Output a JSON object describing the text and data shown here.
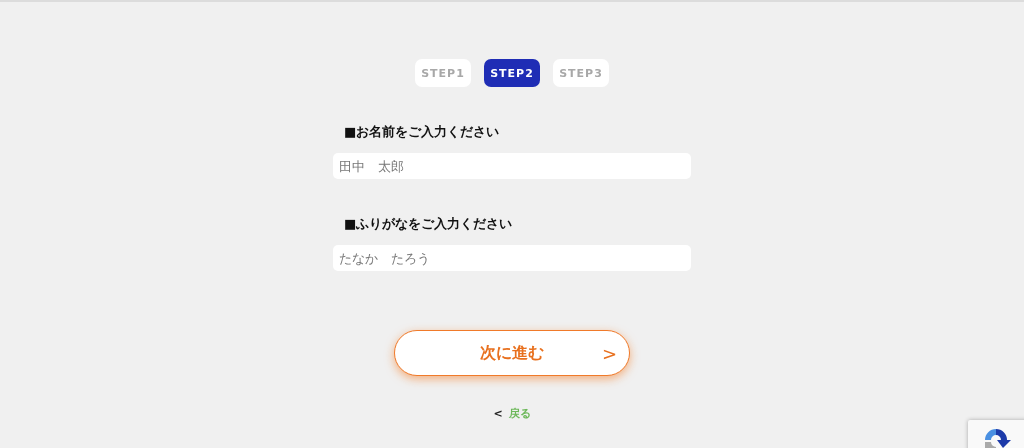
{
  "steps": [
    {
      "label": "STEP1",
      "selected": false
    },
    {
      "label": "STEP2",
      "selected": true
    },
    {
      "label": "STEP3",
      "selected": false
    }
  ],
  "fields": [
    {
      "label": "■お名前をご入力ください",
      "placeholder": "田中　太郎"
    },
    {
      "label": "■ふりがなをご入力ください",
      "placeholder": "たなか　たろう"
    }
  ],
  "next_button": {
    "label": "次に進む",
    "arrow": ">"
  },
  "back_link": {
    "arrow": "<",
    "label": "戻る"
  }
}
